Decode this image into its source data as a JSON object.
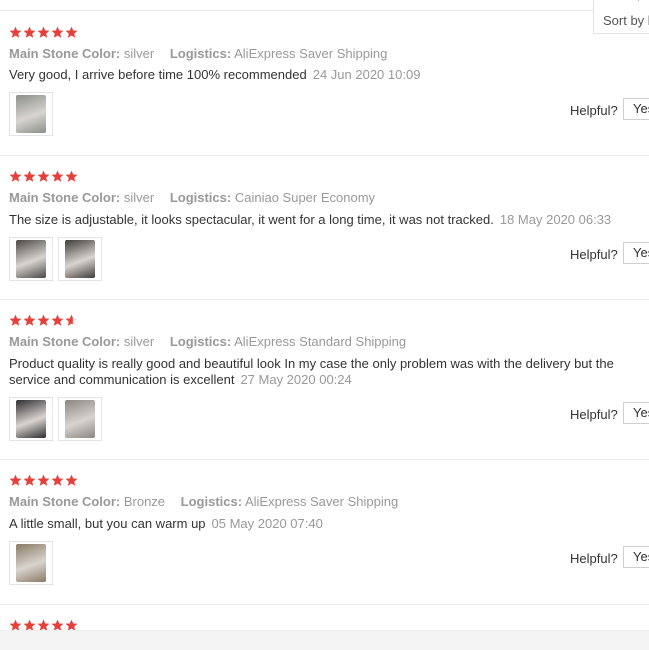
{
  "sort": {
    "label": "Sort by l",
    "chevron": "▾"
  },
  "colors": {
    "star": "#e5403b",
    "star_empty": "#e6e6e6"
  },
  "reviews": [
    {
      "rating": 5,
      "attr_label": "Main Stone Color:",
      "attr_value": "silver",
      "logistics_label": "Logistics:",
      "logistics_value": "AliExpress Saver Shipping",
      "text": "Very good, I arrive before time 100% recommended",
      "date": "24 Jun 2020 10:09",
      "photos": [
        {
          "icon": "ring-photo-icon",
          "color": "#8a8f88"
        }
      ],
      "helpful_label": "Helpful?",
      "yes_label": "Yes"
    },
    {
      "rating": 5,
      "attr_label": "Main Stone Color:",
      "attr_value": "silver",
      "logistics_label": "Logistics:",
      "logistics_value": "Cainiao Super Economy",
      "text": "The size is adjustable, it looks spectacular, it went for a long time, it was not tracked.",
      "date": "18 May 2020 06:33",
      "photos": [
        {
          "icon": "ring-photo-icon",
          "color": "#4a4746"
        },
        {
          "icon": "ring-photo-icon",
          "color": "#3f3b38"
        }
      ],
      "helpful_label": "Helpful?",
      "yes_label": "Yes"
    },
    {
      "rating": 4.5,
      "attr_label": "Main Stone Color:",
      "attr_value": "silver",
      "logistics_label": "Logistics:",
      "logistics_value": "AliExpress Standard Shipping",
      "text": "Product quality is really good and beautiful look In my case the only problem was with the delivery but the service and communication is excellent",
      "date": "27 May 2020 00:24",
      "photos": [
        {
          "icon": "ring-photo-icon",
          "color": "#2d2d2f"
        },
        {
          "icon": "ring-photo-icon",
          "color": "#8b8583"
        }
      ],
      "helpful_label": "Helpful?",
      "yes_label": "Yes"
    },
    {
      "rating": 5,
      "attr_label": "Main Stone Color:",
      "attr_value": "Bronze",
      "logistics_label": "Logistics:",
      "logistics_value": "AliExpress Saver Shipping",
      "text": "A little small, but you can warm up",
      "date": "05 May 2020 07:40",
      "photos": [
        {
          "icon": "ring-photo-icon",
          "color": "#8b7a64"
        }
      ],
      "helpful_label": "Helpful?",
      "yes_label": "Yes"
    },
    {
      "rating": 5
    }
  ]
}
